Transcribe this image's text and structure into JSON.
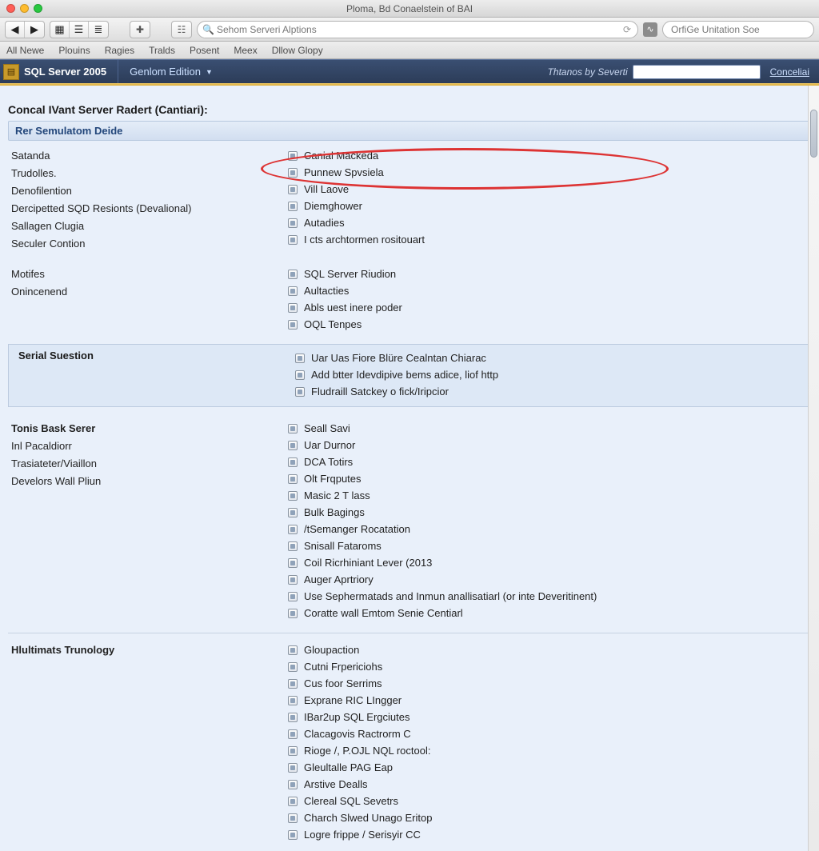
{
  "window": {
    "title": "Ploma, Bd Conaelstein of BAI"
  },
  "toolbar": {
    "address_text": "Sehom Serveri Alptions",
    "side_text": "OrfiGe Unitation Soe"
  },
  "bookmarks": [
    "All Newe",
    "Plouins",
    "Ragies",
    "Tralds",
    "Posent",
    "Meex",
    "Dllow Glopy"
  ],
  "app": {
    "product": "SQL Server 2005",
    "edition": "Genlom Edition",
    "search_label": "Thtanos by Severti",
    "right_link": "Conceliai"
  },
  "page": {
    "title": "Concal IVant Server Radert (Cantiari):",
    "section1_header": "Rer Semulatom Deide",
    "left1": [
      "Satanda",
      "Trudolles.",
      "Denofilention",
      "Dercipetted SQD Resionts (Devalional)",
      "Sallagen Clugia",
      "Seculer Contion"
    ],
    "right1": [
      "Canial Mackeda",
      "Punnew Spvsiela",
      "Vill Laove",
      "Diemghower",
      "Autadies",
      "I cts archtormen rositouart"
    ],
    "left2": [
      "Motifes",
      "Onincenend"
    ],
    "right2": [
      "SQL Server Riudion",
      "Aultacties",
      "Abls uest inere poder",
      "OQL Tenpes"
    ],
    "sub_title": "Serial Suestion",
    "sub_items": [
      "Uar Uas Fiore Blüre Cealntan Chiarac",
      "Add btter Idevdipive bems adice, liof http",
      "Fludraill Satckey o fick/Iripcior"
    ],
    "sec3_left": [
      "Tonis Bask Serer",
      "Inl Pacaldiorr",
      "Trasiateter/Viaillon",
      "Develors Wall Pliun"
    ],
    "sec3_right": [
      "Seall Savi",
      "Uar Durnor",
      "DCA Totirs",
      "Olt Frqputes",
      "Masic 2 T lass",
      "Bulk Bagings",
      "/tSemanger Rocatation",
      "Snisall Fataroms",
      "Coil Ricrhiniant Lever (2013",
      "Auger Aprtriory",
      "Use Sephermatads and Inmun anallisatiarl (or inte Deveritinent)",
      "Coratte wall Emtom Senie Centiarl"
    ],
    "sec4_title": "Hlultimats Trunology",
    "sec4_right": [
      "Gloupaction",
      "Cutni Frpericiohs",
      "Cus foor Serrims",
      "Exprane RIC LIngger",
      "IBar2up SQL Ergciutes",
      "Clacagovis Ractrorm C",
      "Rioge /, P.OJL NQL roctool:",
      "Gleultalle PAG Eap",
      "Arstive Dealls",
      "Clereal SQL Sevetrs",
      "Charch Slwed Unago Eritop",
      "Logre frippe /  Serisyir CC"
    ]
  }
}
